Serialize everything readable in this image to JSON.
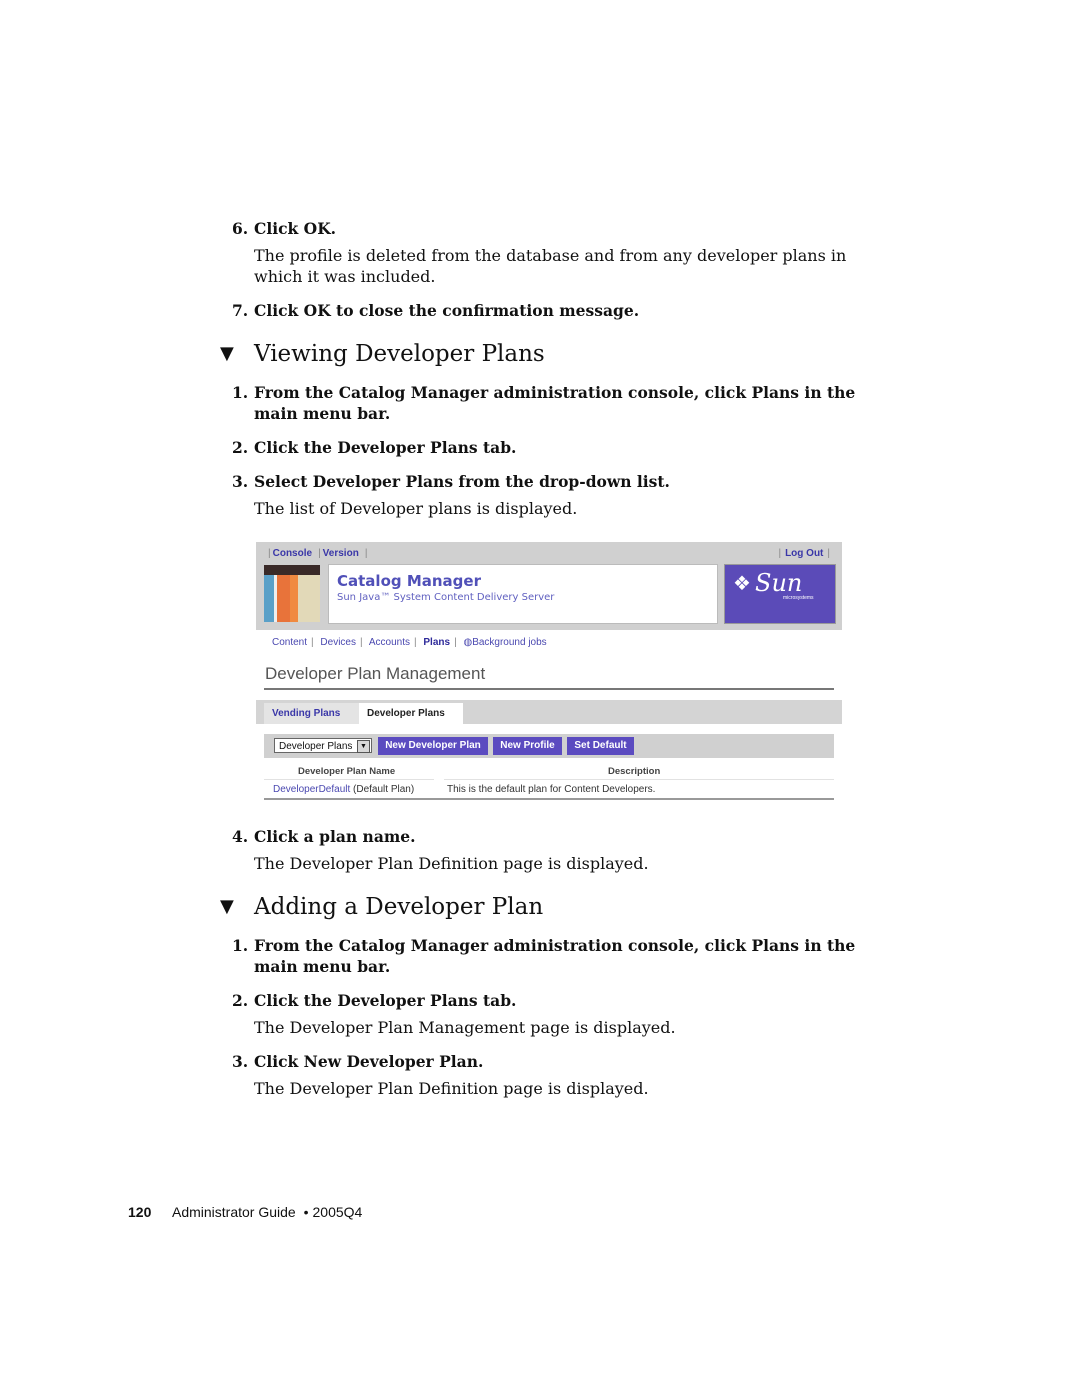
{
  "steps_top": [
    {
      "number": "6.",
      "text": "Click OK.",
      "description": "The profile is deleted from the database and from any developer plans in which it was included."
    },
    {
      "number": "7.",
      "text": "Click OK to close the confirmation message."
    }
  ],
  "section_viewing": {
    "heading_icon": "triangle-down-icon",
    "heading_glyph": "▼",
    "title": "Viewing Developer Plans",
    "steps": [
      {
        "number": "1.",
        "text": "From the Catalog Manager administration console, click Plans in the main menu bar."
      },
      {
        "number": "2.",
        "text": "Click the Developer Plans tab."
      },
      {
        "number": "3.",
        "text": "Select Developer Plans from the drop-down list.",
        "description": "The list of Developer plans is displayed."
      },
      {
        "number": "4.",
        "text": "Click a plan name.",
        "description": "The Developer Plan Definition page is displayed."
      }
    ]
  },
  "screenshot": {
    "top_links": [
      "Console",
      "Version"
    ],
    "logout": "Log Out",
    "app_title": "Catalog Manager",
    "app_subtitle": "Sun Java™ System Content Delivery Server",
    "logo_text": "Sun",
    "logo_subtext": "microsystems",
    "main_menu": [
      "Content",
      "Devices",
      "Accounts",
      "Plans",
      "Background jobs"
    ],
    "main_menu_active": "Plans",
    "background_jobs_icon": "◍",
    "page_title": "Developer Plan Management",
    "tabs": [
      "Vending Plans",
      "Developer Plans"
    ],
    "active_tab": "Developer Plans",
    "select_value": "Developer Plans",
    "buttons": [
      "New Developer Plan",
      "New Profile",
      "Set Default"
    ],
    "table": {
      "columns": [
        "Developer Plan Name",
        "Description"
      ],
      "rows": [
        {
          "name_link": "DeveloperDefault",
          "name_suffix": " (Default Plan)",
          "description": "This is the default plan for Content Developers."
        }
      ]
    },
    "colors": {
      "accent": "#5b4bc0",
      "link": "#4a48b0",
      "masthead": "#d0d0d0"
    }
  },
  "section_adding": {
    "heading_glyph": "▼",
    "title": "Adding a Developer Plan",
    "steps": [
      {
        "number": "1.",
        "text": "From the Catalog Manager administration console, click Plans in the main menu bar."
      },
      {
        "number": "2.",
        "text": "Click the Developer Plans tab.",
        "description": "The Developer Plan Management page is displayed."
      },
      {
        "number": "3.",
        "text": "Click New Developer Plan.",
        "description": "The Developer Plan Definition page is displayed."
      }
    ]
  },
  "footer": {
    "page_number": "120",
    "title": "Administrator Guide",
    "bullet": "•",
    "version": "2005Q4"
  }
}
